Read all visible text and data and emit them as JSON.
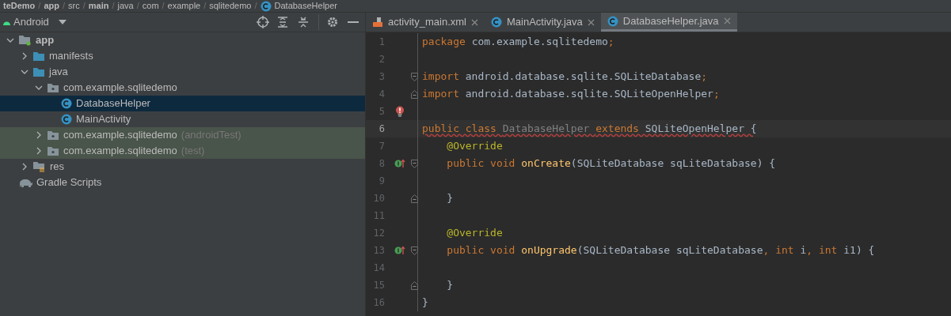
{
  "breadcrumb": [
    {
      "label": "teDemo"
    },
    {
      "separator": "/",
      "label": "app"
    },
    {
      "separator": "/",
      "label": "src"
    },
    {
      "separator": "/",
      "label": "main"
    },
    {
      "separator": "/",
      "label": "java"
    },
    {
      "separator": "/",
      "label": "com"
    },
    {
      "separator": "/",
      "label": "example"
    },
    {
      "separator": "/",
      "label": "sqlitedemo"
    },
    {
      "separator": "/",
      "label": "DatabaseHelper"
    }
  ],
  "project_panel": {
    "view": "Android"
  },
  "tree": [
    {
      "label": "app",
      "kind": "module",
      "expanded": true,
      "selected": false,
      "children": [
        {
          "label": "manifests",
          "kind": "folder",
          "expanded": false,
          "selected": false
        },
        {
          "label": "java",
          "kind": "folder",
          "expanded": true,
          "selected": false,
          "children": [
            {
              "label": "com.example.sqlitedemo",
              "kind": "package",
              "expanded": true,
              "selected": false,
              "test": false,
              "children": [
                {
                  "label": "DatabaseHelper",
                  "kind": "class",
                  "selected": true
                },
                {
                  "label": "MainActivity",
                  "kind": "class",
                  "selected": false
                }
              ]
            },
            {
              "label": "com.example.sqlitedemo",
              "suffix": "(androidTest)",
              "kind": "package",
              "expanded": false,
              "selected": false,
              "test": true
            },
            {
              "label": "com.example.sqlitedemo",
              "suffix": "(test)",
              "kind": "package",
              "expanded": false,
              "selected": false,
              "test": true
            }
          ]
        },
        {
          "label": "res",
          "kind": "res",
          "expanded": false,
          "selected": false
        }
      ]
    },
    {
      "label": "Gradle Scripts",
      "kind": "gradle",
      "selected": false
    }
  ],
  "tabs": [
    {
      "label": "activity_main.xml",
      "kind": "xml",
      "selected": false
    },
    {
      "label": "MainActivity.java",
      "kind": "class",
      "selected": false
    },
    {
      "label": "DatabaseHelper.java",
      "kind": "class",
      "selected": true
    }
  ],
  "code": [
    {
      "number": "1",
      "current": false,
      "fold_start": false,
      "fold_end": false,
      "override": false,
      "error_bulb": false,
      "tokens": [
        {
          "text": "package ",
          "kind": "keyword"
        },
        {
          "text": "com.example.sqlitedemo",
          "kind": "plain"
        },
        {
          "text": ";",
          "kind": "keyword"
        }
      ]
    },
    {
      "number": "2",
      "current": false,
      "fold_start": false,
      "fold_end": false,
      "override": false,
      "error_bulb": false
    },
    {
      "number": "3",
      "current": false,
      "fold_start": true,
      "fold_end": false,
      "override": false,
      "error_bulb": false,
      "tokens": [
        {
          "text": "import ",
          "kind": "keyword"
        },
        {
          "text": "android.database.sqlite.SQLiteDatabase",
          "kind": "plain"
        },
        {
          "text": ";",
          "kind": "keyword"
        }
      ]
    },
    {
      "number": "4",
      "current": false,
      "fold_start": false,
      "fold_end": true,
      "override": false,
      "error_bulb": false,
      "tokens": [
        {
          "text": "import ",
          "kind": "keyword"
        },
        {
          "text": "android.database.sqlite.SQLiteOpenHelper",
          "kind": "plain"
        },
        {
          "text": ";",
          "kind": "keyword"
        }
      ]
    },
    {
      "number": "5",
      "current": false,
      "fold_start": false,
      "fold_end": false,
      "override": false,
      "error_bulb": true
    },
    {
      "number": "6",
      "current": true,
      "error": true,
      "fold_start": false,
      "fold_end": false,
      "override": false,
      "error_bulb": false,
      "tokens": [
        {
          "text": "public class ",
          "kind": "keyword"
        },
        {
          "text": "DatabaseHelper ",
          "kind": "unused"
        },
        {
          "text": "extends ",
          "kind": "keyword"
        },
        {
          "text": "SQLiteOpenHelper ",
          "kind": "plain"
        },
        {
          "text": "{",
          "kind": "plain"
        }
      ]
    },
    {
      "number": "7",
      "current": false,
      "fold_start": false,
      "fold_end": false,
      "override": false,
      "error_bulb": false,
      "tokens": [
        {
          "text": "    @Override",
          "kind": "annotation"
        }
      ]
    },
    {
      "number": "8",
      "current": false,
      "fold_start": true,
      "fold_end": false,
      "override": true,
      "error_bulb": false,
      "tokens": [
        {
          "text": "    public void ",
          "kind": "keyword"
        },
        {
          "text": "onCreate",
          "kind": "method"
        },
        {
          "text": "(SQLiteDatabase sqLiteDatabase) {",
          "kind": "plain"
        }
      ]
    },
    {
      "number": "9",
      "current": false,
      "fold_start": false,
      "fold_end": false,
      "override": false,
      "error_bulb": false
    },
    {
      "number": "10",
      "current": false,
      "fold_start": false,
      "fold_end": true,
      "override": false,
      "error_bulb": false,
      "tokens": [
        {
          "text": "    }",
          "kind": "plain"
        }
      ]
    },
    {
      "number": "11",
      "current": false,
      "fold_start": false,
      "fold_end": false,
      "override": false,
      "error_bulb": false
    },
    {
      "number": "12",
      "current": false,
      "fold_start": false,
      "fold_end": false,
      "override": false,
      "error_bulb": false,
      "tokens": [
        {
          "text": "    @Override",
          "kind": "annotation"
        }
      ]
    },
    {
      "number": "13",
      "current": false,
      "fold_start": true,
      "fold_end": false,
      "override": true,
      "error_bulb": false,
      "tokens": [
        {
          "text": "    public void ",
          "kind": "keyword"
        },
        {
          "text": "onUpgrade",
          "kind": "method"
        },
        {
          "text": "(SQLiteDatabase sqLiteDatabase",
          "kind": "plain"
        },
        {
          "text": ", int ",
          "kind": "keyword"
        },
        {
          "text": "i",
          "kind": "plain"
        },
        {
          "text": ", int ",
          "kind": "keyword"
        },
        {
          "text": "i1) {",
          "kind": "plain"
        }
      ]
    },
    {
      "number": "14",
      "current": false,
      "fold_start": false,
      "fold_end": false,
      "override": false,
      "error_bulb": false
    },
    {
      "number": "15",
      "current": false,
      "fold_start": false,
      "fold_end": true,
      "override": false,
      "error_bulb": false,
      "tokens": [
        {
          "text": "    }",
          "kind": "plain"
        }
      ]
    },
    {
      "number": "16",
      "current": false,
      "fold_start": false,
      "fold_end": false,
      "override": false,
      "error_bulb": false,
      "tokens": [
        {
          "text": "}",
          "kind": "plain"
        }
      ]
    }
  ]
}
